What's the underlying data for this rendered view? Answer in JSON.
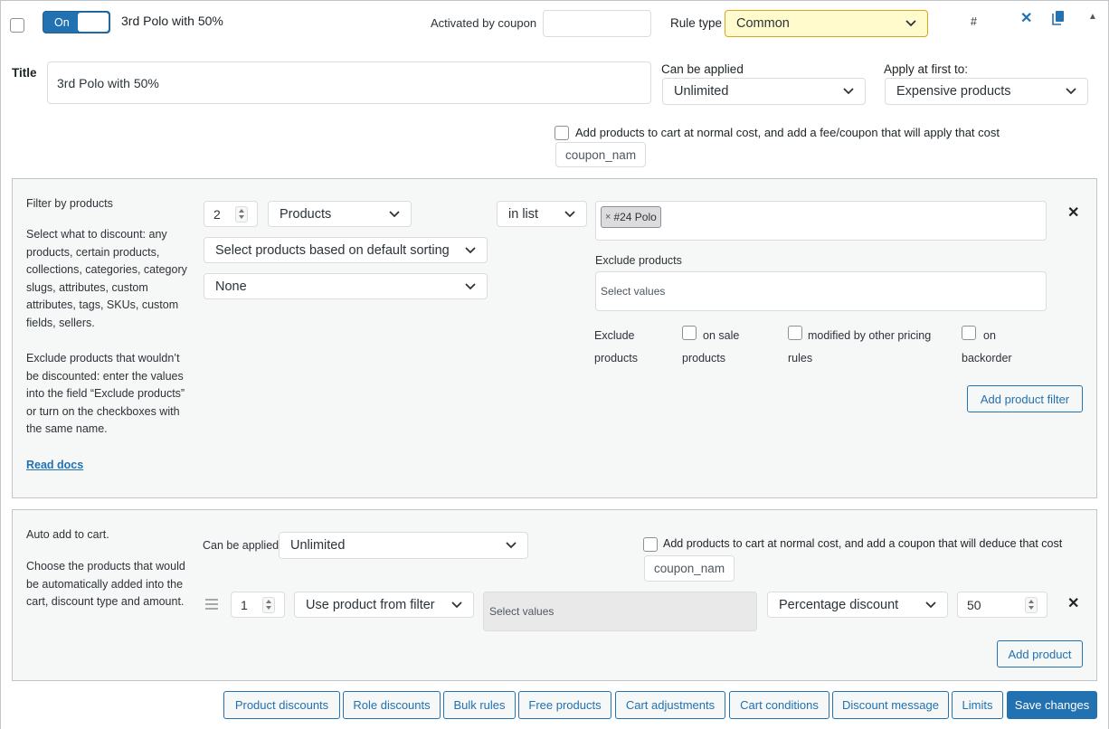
{
  "header": {
    "toggle_label": "On",
    "rule_title": "3rd Polo with 50%",
    "activated_by_coupon_label": "Activated by coupon",
    "activated_by_coupon_value": "",
    "rule_type_label": "Rule type",
    "rule_type_value": "Common",
    "hash": "#",
    "close_glyph": "✕",
    "collapse_glyph": "▲"
  },
  "title_row": {
    "title_label": "Title",
    "title_value": "3rd Polo with 50%",
    "can_be_applied_label": "Can be applied",
    "can_be_applied_value": "Unlimited",
    "apply_first_label": "Apply at first to:",
    "apply_first_value": "Expensive products",
    "fee_label": "Add products to cart at normal cost, and add a fee/coupon that will apply that cost",
    "coupon_placeholder": "coupon_nam"
  },
  "filter": {
    "heading": "Filter by products",
    "desc1": "Select what to discount: any products, certain products, collections, categories, category slugs, attributes, custom attributes, tags, SKUs, custom fields, sellers.",
    "desc2": "Exclude products that wouldn’t be discounted: enter the values into the field “Exclude products” or turn on the checkboxes with the same name.",
    "read_docs": "Read docs",
    "qty": "2",
    "type_value": "Products",
    "method_value": "in list",
    "tag_x": "×",
    "tag_value": "#24 Polo",
    "sorting_value": "Select products based on default sorting",
    "none_value": "None",
    "exclude_label": "Exclude products",
    "exclude_placeholder": "Select values",
    "exclude_products_line1": "Exclude",
    "exclude_products_line2": "products",
    "on_sale_line1": "on sale",
    "on_sale_line2": "products",
    "modified_line1": "modified by other pricing",
    "modified_line2": "rules",
    "backorder_line1": "on",
    "backorder_line2": "backorder",
    "add_filter_button": "Add product filter",
    "remove_glyph": "✕"
  },
  "auto_add": {
    "heading": "Auto add to cart.",
    "desc": "Choose the products that would be automatically added into the cart, discount type and amount.",
    "can_be_applied_label": "Can be applied",
    "can_be_applied_value": "Unlimited",
    "normal_cost_label": "Add products to cart at normal cost, and add a coupon that will deduce that cost",
    "coupon_placeholder": "coupon_nam",
    "qty": "1",
    "source_value": "Use product from filter",
    "values_placeholder": "Select values",
    "discount_type_value": "Percentage discount",
    "discount_amount": "50",
    "add_product_button": "Add product",
    "remove_glyph": "✕"
  },
  "footer": {
    "buttons": [
      "Product discounts",
      "Role discounts",
      "Bulk rules",
      "Free products",
      "Cart adjustments",
      "Cart conditions",
      "Discount message",
      "Limits"
    ],
    "save_button": "Save changes"
  },
  "colors": {
    "accent": "#2271b1",
    "rule_type_bg": "#fffbcc",
    "rule_type_border": "#dba617"
  }
}
